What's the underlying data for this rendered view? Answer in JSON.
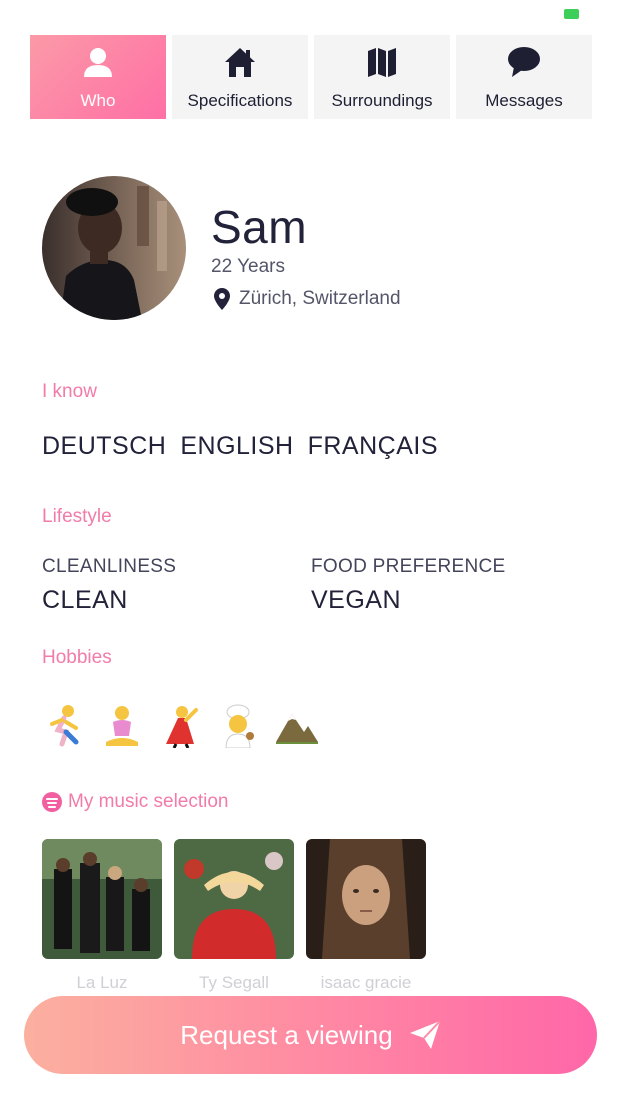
{
  "tabs": [
    {
      "label": "Who",
      "icon": "user-icon",
      "active": true
    },
    {
      "label": "Specifications",
      "icon": "home-icon",
      "active": false
    },
    {
      "label": "Surroundings",
      "icon": "map-icon",
      "active": false
    },
    {
      "label": "Messages",
      "icon": "chat-bubble-icon",
      "active": false
    }
  ],
  "profile": {
    "name": "Sam",
    "age": "22 Years",
    "location": "Zürich, Switzerland"
  },
  "languages": {
    "title": "I know",
    "items": [
      "DEUTSCH",
      "ENGLISH",
      "FRANÇAIS"
    ]
  },
  "lifestyle": {
    "title": "Lifestyle",
    "cleanliness_label": "CLEANLINESS",
    "cleanliness_value": "CLEAN",
    "food_label": "FOOD PREFERENCE",
    "food_value": "VEGAN"
  },
  "hobbies": {
    "title": "Hobbies",
    "items": [
      "running-emoji",
      "yoga-emoji",
      "dancing-emoji",
      "cooking-emoji",
      "mountain-emoji"
    ]
  },
  "music": {
    "title": "My music selection",
    "albums": [
      {
        "artist": "La Luz"
      },
      {
        "artist": "Ty Segall"
      },
      {
        "artist": "isaac gracie"
      }
    ]
  },
  "cta": {
    "label": "Request a viewing"
  },
  "colors": {
    "accent": "#f27ba9",
    "gradient_start": "#fbb09f",
    "gradient_end": "#ff67a8",
    "text": "#22223a"
  }
}
